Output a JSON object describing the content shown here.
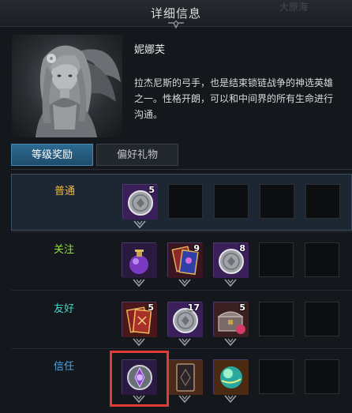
{
  "header": {
    "title": "详细信息",
    "ghost_text": "大原海"
  },
  "character": {
    "name": "妮娜芙",
    "description": "拉杰尼斯的弓手，也是结束锁链战争的神选英雄之一。性格开朗，可以和中间界的所有生命进行沟通。"
  },
  "tabs": [
    {
      "label": "等级奖励",
      "active": true
    },
    {
      "label": "偏好礼物",
      "active": false
    }
  ],
  "colors": {
    "label_normal": "#f0b93a",
    "label_follow": "#8fe043",
    "label_friendly": "#40d6c8",
    "label_trust": "#4aa6e8",
    "highlight": "#e23a36",
    "tab_active": "#2e6a92"
  },
  "rows": [
    {
      "label": "普通",
      "color": "#f0b93a",
      "slots": [
        {
          "icon": "silver-coin-icon",
          "count": "5"
        },
        {
          "icon": "empty"
        },
        {
          "icon": "empty"
        },
        {
          "icon": "empty"
        },
        {
          "icon": "empty"
        }
      ]
    },
    {
      "label": "关注",
      "color": "#8fe043",
      "slots": [
        {
          "icon": "potion-icon",
          "count": ""
        },
        {
          "icon": "card-book-icon",
          "count": "9"
        },
        {
          "icon": "silver-coin-icon",
          "count": "8"
        },
        {
          "icon": "empty"
        },
        {
          "icon": "empty"
        }
      ]
    },
    {
      "label": "友好",
      "color": "#40d6c8",
      "slots": [
        {
          "icon": "card-book-icon",
          "count": "5"
        },
        {
          "icon": "silver-coin-icon",
          "count": "17"
        },
        {
          "icon": "treasure-chest-icon",
          "count": "5"
        },
        {
          "icon": "empty"
        },
        {
          "icon": "empty"
        }
      ]
    },
    {
      "label": "信任",
      "color": "#4aa6e8",
      "slots": [
        {
          "icon": "emblem-icon",
          "count": ""
        },
        {
          "icon": "card-back-icon",
          "count": ""
        },
        {
          "icon": "orb-icon",
          "count": ""
        },
        {
          "icon": "empty"
        },
        {
          "icon": "empty"
        }
      ]
    }
  ]
}
